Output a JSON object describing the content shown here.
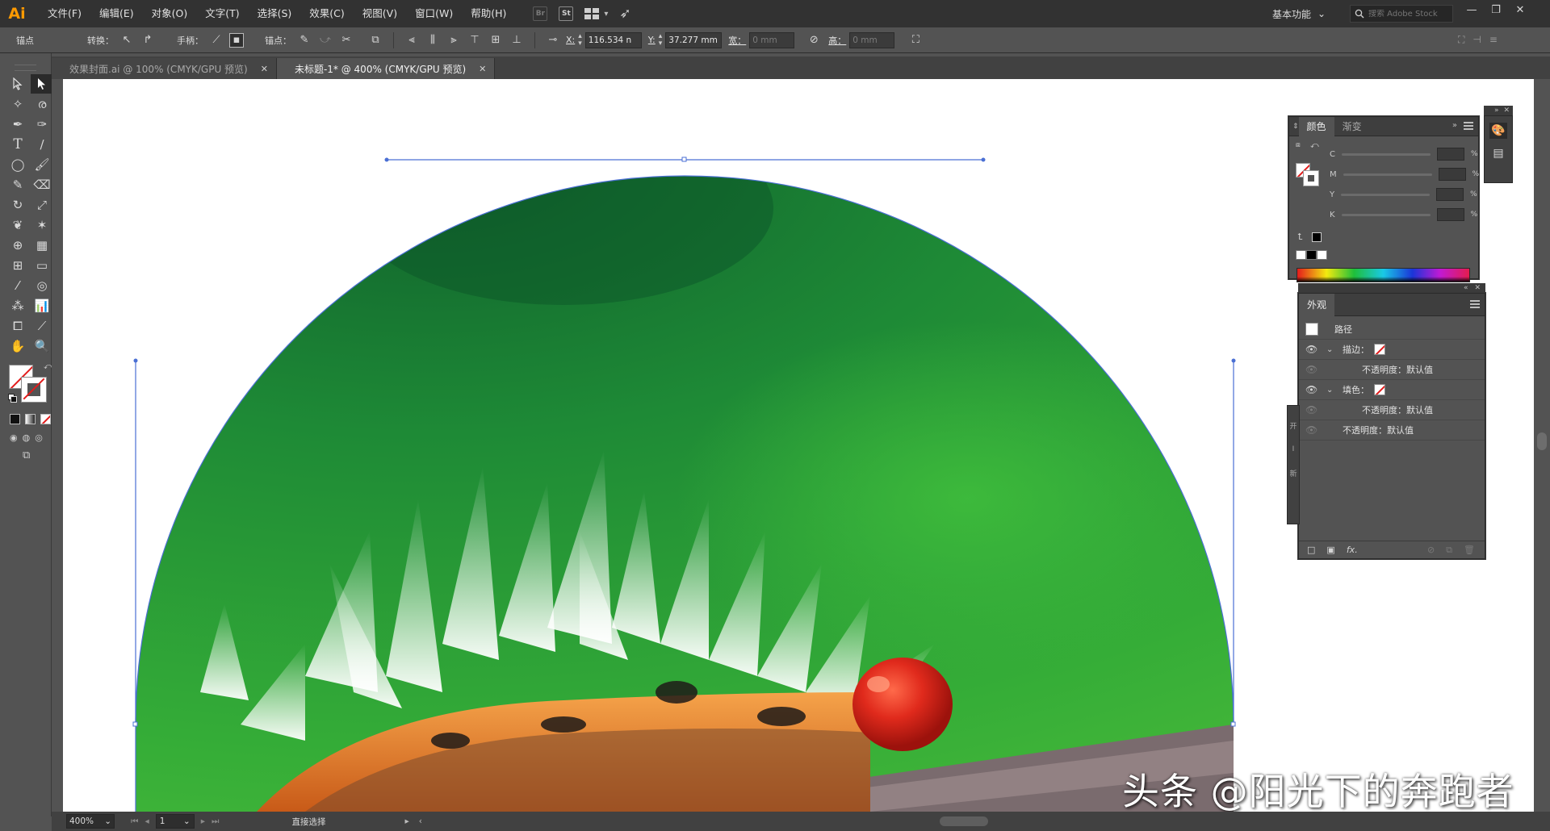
{
  "app": {
    "logo": "Ai"
  },
  "menu": [
    "文件(F)",
    "编辑(E)",
    "对象(O)",
    "文字(T)",
    "选择(S)",
    "效果(C)",
    "视图(V)",
    "窗口(W)",
    "帮助(H)"
  ],
  "menu_icons": {
    "bridge": "Br",
    "stock": "St"
  },
  "workspace": {
    "label": "基本功能"
  },
  "search": {
    "placeholder": "搜索 Adobe Stock"
  },
  "window_controls": {
    "minimize": "—",
    "restore": "❐",
    "close": "✕"
  },
  "control_bar": {
    "selection_label": "锚点",
    "convert_label": "转换：",
    "handles_label": "手柄：",
    "anchors_label": "锚点：",
    "x_label": "X:",
    "x_value": "116.534 n",
    "y_label": "Y:",
    "y_value": "37.277 mm",
    "w_label": "宽：",
    "w_value": "0 mm",
    "h_label": "高：",
    "h_value": "0 mm"
  },
  "tabs": [
    {
      "label": "效果封面.ai @ 100% (CMYK/GPU 预览)",
      "active": false
    },
    {
      "label": "未标题-1* @ 400% (CMYK/GPU 预览)",
      "active": true
    }
  ],
  "status": {
    "zoom": "400%",
    "page": "1",
    "tool": "直接选择"
  },
  "color_panel": {
    "tabs": [
      "颜色",
      "渐变"
    ],
    "channels": [
      "C",
      "M",
      "Y",
      "K"
    ],
    "percent": "%"
  },
  "appearance_panel": {
    "title": "外观",
    "object": "路径",
    "rows": [
      {
        "label": "描边：",
        "type": "stroke"
      },
      {
        "label": "不透明度：默认值",
        "type": "sub"
      },
      {
        "label": "填色：",
        "type": "fill"
      },
      {
        "label": "不透明度：默认值",
        "type": "sub"
      },
      {
        "label": "不透明度：默认值",
        "type": "top"
      }
    ],
    "fx": "fx."
  },
  "hidden_panel_letters": [
    "开",
    "I",
    "新"
  ],
  "watermark": "头条 @阳光下的奔跑者",
  "colors": {
    "accent_logo": "#ff9a00",
    "selection": "#4a6fd4",
    "leaf_green": "#2fa637",
    "caterpillar_red": "#d8261c"
  }
}
